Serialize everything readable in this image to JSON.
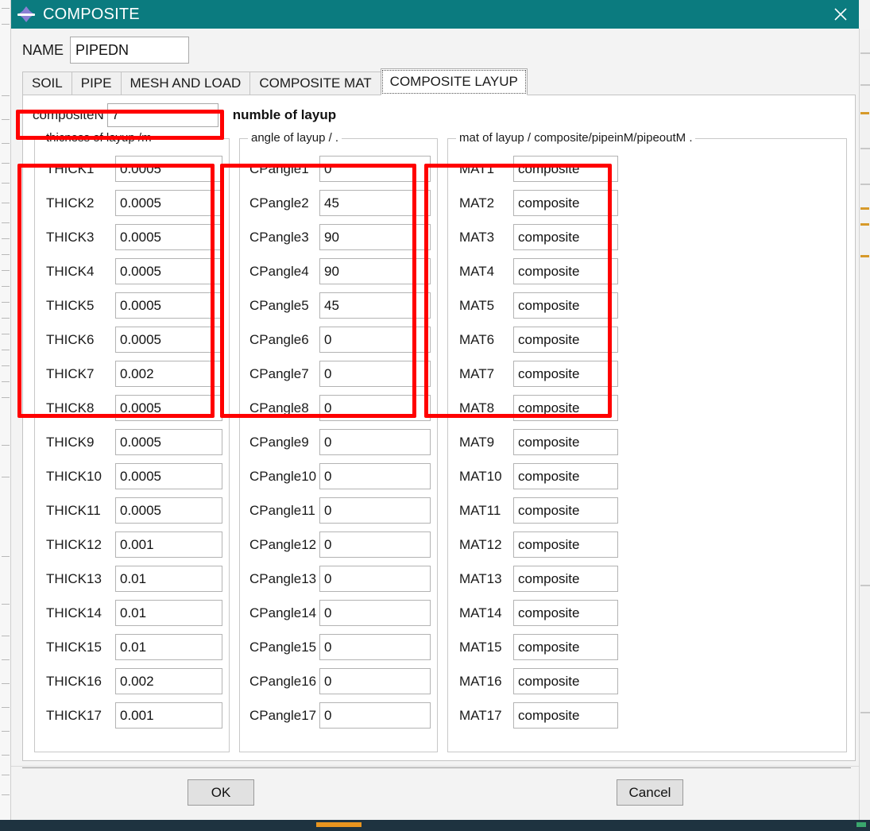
{
  "window": {
    "title": "COMPOSITE",
    "icon": "composite-app-icon",
    "close_label": "✕"
  },
  "name_field": {
    "label": "NAME",
    "value": "PIPEDN"
  },
  "tabs": [
    {
      "label": "SOIL",
      "active": false
    },
    {
      "label": "PIPE",
      "active": false
    },
    {
      "label": "MESH AND LOAD",
      "active": false
    },
    {
      "label": "COMPOSITE MAT",
      "active": false
    },
    {
      "label": "COMPOSITE LAYUP",
      "active": true
    }
  ],
  "composite_n": {
    "label": "compositeN",
    "value": "7",
    "hint": "numble of layup"
  },
  "groups": {
    "thickness": {
      "title": "thicness of layup /m",
      "rows": [
        {
          "label": "THICK1",
          "value": "0.0005"
        },
        {
          "label": "THICK2",
          "value": "0.0005"
        },
        {
          "label": "THICK3",
          "value": "0.0005"
        },
        {
          "label": "THICK4",
          "value": "0.0005"
        },
        {
          "label": "THICK5",
          "value": "0.0005"
        },
        {
          "label": "THICK6",
          "value": "0.0005"
        },
        {
          "label": "THICK7",
          "value": "0.002"
        },
        {
          "label": "THICK8",
          "value": "0.0005"
        },
        {
          "label": "THICK9",
          "value": "0.0005"
        },
        {
          "label": "THICK10",
          "value": "0.0005"
        },
        {
          "label": "THICK11",
          "value": "0.0005"
        },
        {
          "label": "THICK12",
          "value": "0.001"
        },
        {
          "label": "THICK13",
          "value": "0.01"
        },
        {
          "label": "THICK14",
          "value": "0.01"
        },
        {
          "label": "THICK15",
          "value": "0.01"
        },
        {
          "label": "THICK16",
          "value": "0.002"
        },
        {
          "label": "THICK17",
          "value": "0.001"
        }
      ]
    },
    "angle": {
      "title": "angle of layup / .",
      "rows": [
        {
          "label": "CPangle1",
          "value": "0"
        },
        {
          "label": "CPangle2",
          "value": "45"
        },
        {
          "label": "CPangle3",
          "value": "90"
        },
        {
          "label": "CPangle4",
          "value": "90"
        },
        {
          "label": "CPangle5",
          "value": "45"
        },
        {
          "label": "CPangle6",
          "value": "0"
        },
        {
          "label": "CPangle7",
          "value": "0"
        },
        {
          "label": "CPangle8",
          "value": "0"
        },
        {
          "label": "CPangle9",
          "value": "0"
        },
        {
          "label": "CPangle10",
          "value": "0"
        },
        {
          "label": "CPangle11",
          "value": "0"
        },
        {
          "label": "CPangle12",
          "value": "0"
        },
        {
          "label": "CPangle13",
          "value": "0"
        },
        {
          "label": "CPangle14",
          "value": "0"
        },
        {
          "label": "CPangle15",
          "value": "0"
        },
        {
          "label": "CPangle16",
          "value": "0"
        },
        {
          "label": "CPangle17",
          "value": "0"
        }
      ]
    },
    "mat": {
      "title": "mat of layup / composite/pipeinM/pipeoutM .",
      "rows": [
        {
          "label": "MAT1",
          "value": "composite"
        },
        {
          "label": "MAT2",
          "value": "composite"
        },
        {
          "label": "MAT3",
          "value": "composite"
        },
        {
          "label": "MAT4",
          "value": "composite"
        },
        {
          "label": "MAT5",
          "value": "composite"
        },
        {
          "label": "MAT6",
          "value": "composite"
        },
        {
          "label": "MAT7",
          "value": "composite"
        },
        {
          "label": "MAT8",
          "value": "composite"
        },
        {
          "label": "MAT9",
          "value": "composite"
        },
        {
          "label": "MAT10",
          "value": "composite"
        },
        {
          "label": "MAT11",
          "value": "composite"
        },
        {
          "label": "MAT12",
          "value": "composite"
        },
        {
          "label": "MAT13",
          "value": "composite"
        },
        {
          "label": "MAT14",
          "value": "composite"
        },
        {
          "label": "MAT15",
          "value": "composite"
        },
        {
          "label": "MAT16",
          "value": "composite"
        },
        {
          "label": "MAT17",
          "value": "composite"
        }
      ]
    }
  },
  "footer": {
    "ok_label": "OK",
    "cancel_label": "Cancel"
  },
  "annotations": {
    "highlight_color": "#ff0000",
    "boxes": [
      "composite-n-field",
      "thickness-rows-1-7",
      "angle-rows-1-7",
      "mat-rows-1-7"
    ]
  },
  "colors": {
    "titlebar": "#0b7b7f",
    "taskbar": "#1e3340",
    "panel": "#ffffff",
    "dialog": "#f3f3f3"
  }
}
